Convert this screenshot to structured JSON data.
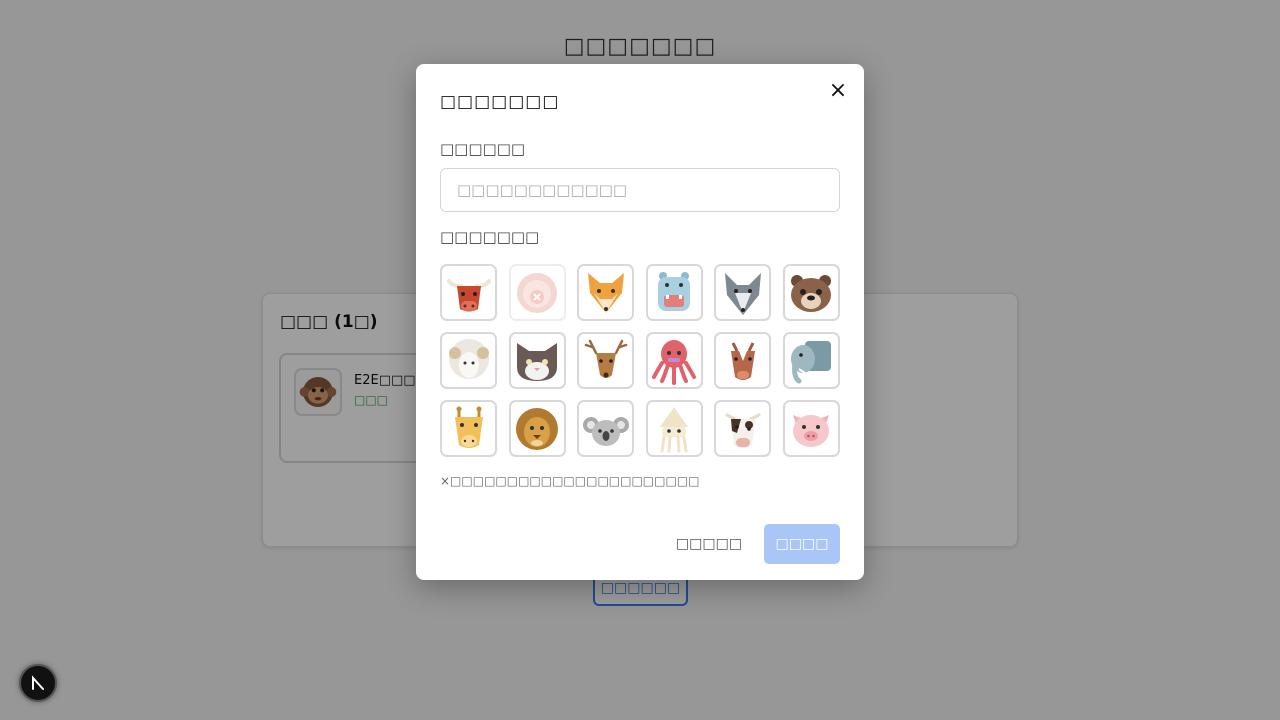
{
  "page": {
    "title": "□□□□□□□"
  },
  "members_panel": {
    "title": "□□□ (1□)",
    "member": {
      "name": "E2E□□□□",
      "status": "□□□",
      "avatar_icon": "monkey-icon"
    }
  },
  "bottom_button": {
    "label": "□□□□□□"
  },
  "modal": {
    "title": "□□□□□□□",
    "close_glyph": "×",
    "name_label": "□□□□□□",
    "name_value": "",
    "name_placeholder": "□□□□□□□□□□□□",
    "avatar_label": "□□□□□□□",
    "avatars": [
      {
        "icon": "bull-icon",
        "disabled": false
      },
      {
        "icon": "lion-cub-icon",
        "disabled": true
      },
      {
        "icon": "fox-icon",
        "disabled": false
      },
      {
        "icon": "hippo-icon",
        "disabled": false
      },
      {
        "icon": "wolf-icon",
        "disabled": false
      },
      {
        "icon": "bear-icon",
        "disabled": false
      },
      {
        "icon": "sheep-icon",
        "disabled": false
      },
      {
        "icon": "cat-icon",
        "disabled": false
      },
      {
        "icon": "deer-icon",
        "disabled": false
      },
      {
        "icon": "octopus-icon",
        "disabled": false
      },
      {
        "icon": "horse-icon",
        "disabled": false
      },
      {
        "icon": "elephant-icon",
        "disabled": false
      },
      {
        "icon": "giraffe-icon",
        "disabled": false
      },
      {
        "icon": "lion-icon",
        "disabled": false
      },
      {
        "icon": "koala-icon",
        "disabled": false
      },
      {
        "icon": "squid-icon",
        "disabled": false
      },
      {
        "icon": "cow-icon",
        "disabled": false
      },
      {
        "icon": "pig-icon",
        "disabled": false
      }
    ],
    "hint": "×□□□□□□□□□□□□□□□□□□□□□□",
    "cancel_label": "□□□□□",
    "submit_label": "□□□□"
  },
  "colors": {
    "accent": "#3a7bef",
    "submit_disabled": "#a9c6f7",
    "status_green": "#3aa04a"
  }
}
